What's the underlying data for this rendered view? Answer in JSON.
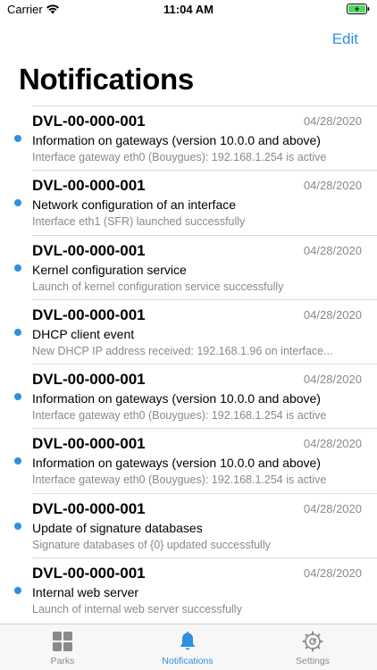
{
  "status_bar": {
    "carrier": "Carrier",
    "time": "11:04 AM"
  },
  "nav": {
    "edit_label": "Edit",
    "title": "Notifications"
  },
  "colors": {
    "accent": "#2f8fe0",
    "secondary_text": "#8a8a8e",
    "battery_fill": "#4cd964"
  },
  "notifications": [
    {
      "id": "DVL-00-000-001",
      "date": "04/28/2020",
      "title": "Information on gateways (version 10.0.0 and above)",
      "detail": "Interface gateway eth0 (Bouygues): 192.168.1.254 is active",
      "unread": true
    },
    {
      "id": "DVL-00-000-001",
      "date": "04/28/2020",
      "title": "Network configuration of an interface",
      "detail": "Interface eth1 (SFR) launched successfully",
      "unread": true
    },
    {
      "id": "DVL-00-000-001",
      "date": "04/28/2020",
      "title": "Kernel configuration service",
      "detail": "Launch of kernel configuration service successfully",
      "unread": true
    },
    {
      "id": "DVL-00-000-001",
      "date": "04/28/2020",
      "title": "DHCP client event",
      "detail": "New DHCP IP address received: 192.168.1.96 on interface...",
      "unread": true
    },
    {
      "id": "DVL-00-000-001",
      "date": "04/28/2020",
      "title": "Information on gateways (version 10.0.0 and above)",
      "detail": "Interface gateway eth0 (Bouygues): 192.168.1.254 is active",
      "unread": true
    },
    {
      "id": "DVL-00-000-001",
      "date": "04/28/2020",
      "title": "Information on gateways (version 10.0.0 and above)",
      "detail": "Interface gateway eth0 (Bouygues): 192.168.1.254 is active",
      "unread": true
    },
    {
      "id": "DVL-00-000-001",
      "date": "04/28/2020",
      "title": "Update of signature databases",
      "detail": "Signature databases of {0} updated successfully",
      "unread": true
    },
    {
      "id": "DVL-00-000-001",
      "date": "04/28/2020",
      "title": "Internal web server",
      "detail": "Launch of internal web server successfully",
      "unread": true
    }
  ],
  "tabs": [
    {
      "label": "Parks",
      "icon": "grid-icon",
      "active": false
    },
    {
      "label": "Notifications",
      "icon": "bell-icon",
      "active": true
    },
    {
      "label": "Settings",
      "icon": "gear-icon",
      "active": false
    }
  ]
}
